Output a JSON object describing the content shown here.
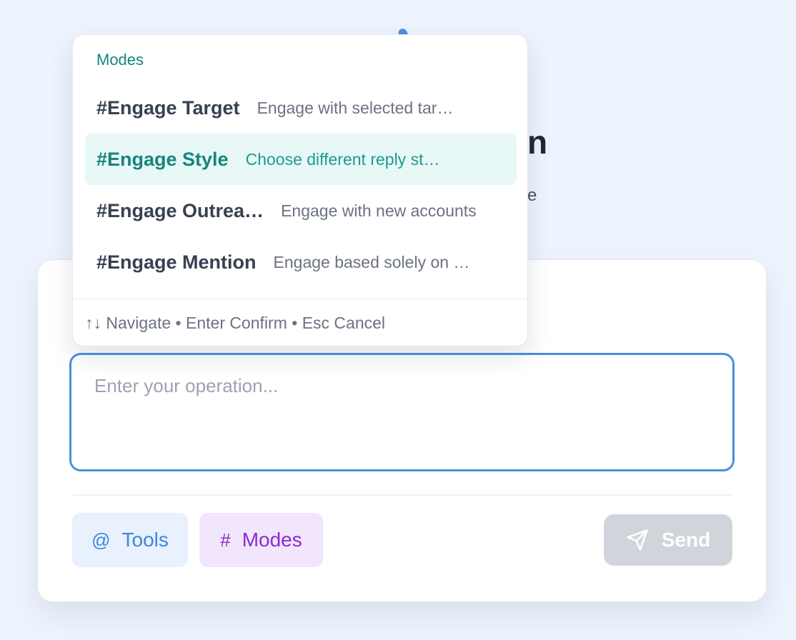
{
  "background": {
    "title_tail": "n",
    "subtitle_tail": "e"
  },
  "composer": {
    "placeholder": "Enter your operation...",
    "tools_chip": {
      "symbol": "@",
      "label": "Tools"
    },
    "modes_chip": {
      "symbol": "#",
      "label": "Modes"
    },
    "send": {
      "label": "Send",
      "icon": "send-icon"
    }
  },
  "popup": {
    "header": "Modes",
    "items": [
      {
        "name": "#Engage Target",
        "desc": "Engage with selected tar…",
        "active": false
      },
      {
        "name": "#Engage Style",
        "desc": "Choose different reply st…",
        "active": true
      },
      {
        "name": "#Engage Outrea…",
        "desc": "Engage with new accounts",
        "active": false
      },
      {
        "name": "#Engage Mention",
        "desc": "Engage based solely on …",
        "active": false
      }
    ],
    "footer": "↑↓ Navigate • Enter Confirm • Esc Cancel"
  },
  "colors": {
    "accent": "#4a8fe0",
    "active_mode": "#16857e",
    "modes_chip": "#8a2bd0",
    "send_disabled": "#d1d5db"
  }
}
